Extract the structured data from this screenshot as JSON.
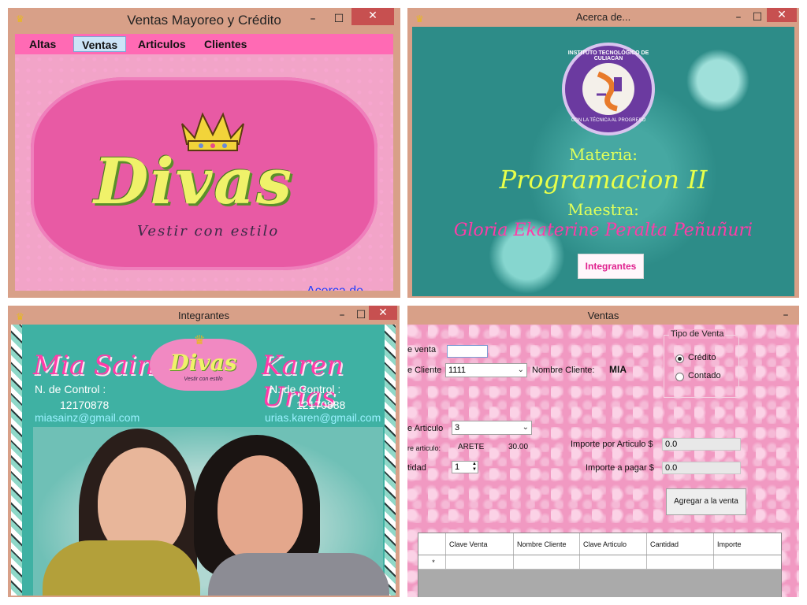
{
  "win1": {
    "title": "Ventas Mayoreo y Crédito",
    "menu": [
      "Altas",
      "Ventas",
      "Articulos",
      "Clientes"
    ],
    "logo_text": "Divas",
    "logo_tagline": "Vestir con estilo",
    "about_link": "Acerca de..."
  },
  "win2": {
    "title": "Acerca de...",
    "seal_top": "INSTITUTO TECNOLÓGICO DE CULIACÁN",
    "seal_bottom": "CON LA TÉCNICA AL PROGRESO",
    "materia_label": "Materia:",
    "materia": "Programacion II",
    "maestra_label": "Maestra:",
    "maestra": "Gloria Ekaterine Peralta Peñuñuri",
    "button": "Integrantes"
  },
  "win3": {
    "title": "Integrantes",
    "logo_text": "Divas",
    "logo_tagline": "Vestir con estilo",
    "members": [
      {
        "name": "Mia Sainz",
        "control_label": "N. de Control :",
        "control": "12170878",
        "email": "miasainz@gmail.com"
      },
      {
        "name": "Karen Urias",
        "control_label": "N. de Control :",
        "control": "12170888",
        "email": "urias.karen@gmail.com"
      }
    ]
  },
  "win4": {
    "title": "Ventas",
    "clave_venta_label": "e venta",
    "clave_venta_value": "",
    "clave_cliente_label": "e Cliente",
    "clave_cliente_value": "1111",
    "nombre_cliente_label": "Nombre Cliente:",
    "nombre_cliente_value": "MIA",
    "tipo_venta_title": "Tipo de Venta",
    "credito": "Crédito",
    "contado": "Contado",
    "clave_articulo_label": "e Articulo",
    "clave_articulo_value": "3",
    "nombre_articulo_label": "re articulo:",
    "nombre_articulo_value": "ARETE",
    "precio_value": "30.00",
    "cantidad_label": "tidad",
    "cantidad_value": "1",
    "importe_articulo_label": "Importe  por Articulo $",
    "importe_articulo_value": "0.0",
    "importe_pagar_label": "Importe a pagar $",
    "importe_pagar_value": "0.0",
    "agregar_button": "Agregar a la venta",
    "grid_headers": [
      "Clave Venta",
      "Nombre Cliente",
      "Clave Articulo",
      "Cantidad",
      "Importe"
    ],
    "new_row_marker": "*"
  },
  "colors": {
    "title_bar": "#d8a088",
    "close_button": "#c75050",
    "menu_pink": "#ff6ab4",
    "link_blue": "#1a3cff",
    "magenta_text": "#ff3ca8"
  },
  "icons": [
    "crown-icon",
    "minimize-icon",
    "maximize-icon",
    "close-icon",
    "dropdown-arrow-icon",
    "spinner-arrows-icon"
  ]
}
